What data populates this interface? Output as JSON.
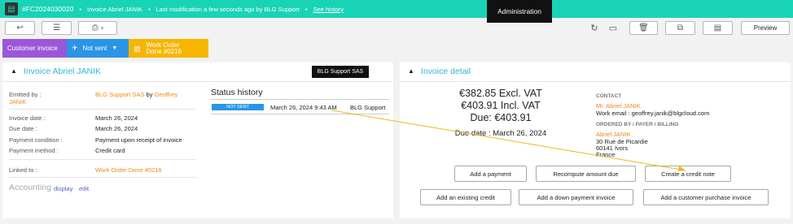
{
  "topbar": {
    "ref": "#FC2024030020",
    "title": "Invoice Abriel JANIK",
    "modification": "Last modification a few seconds ago by BLG Support",
    "history_link": "See history",
    "admin_badge": "Administration",
    "bg_color": "#19d3b6"
  },
  "toolbar": {
    "back_icon": "back-arrow-icon",
    "list_icon": "list-icon",
    "print_icon": "print-icon",
    "reload_icon": "reload-icon",
    "screen_icon": "monitor-icon",
    "trash_icon": "trash-icon",
    "copy_icon": "copy-icon",
    "doc_icon": "document-icon",
    "preview_label": "Preview"
  },
  "status": {
    "type": "Customer invoice",
    "sent": "Not sent",
    "order": "Work Order Done #0216"
  },
  "left_panel": {
    "title": "Invoice Abriel JANIK",
    "badge": "BLG Support SAS",
    "emitted_label": "Emitted by :",
    "emitted_company": "BLG Support SAS",
    "emitted_by": "by",
    "emitted_person": "Geoffrey JANIK",
    "rows": [
      {
        "label": "Invoice date :",
        "value": "March 26, 2024"
      },
      {
        "label": "Due date :",
        "value": "March 26, 2024"
      },
      {
        "label": "Payment condition :",
        "value": "Payment upon receipt of invoice"
      },
      {
        "label": "Payment method :",
        "value": "Credit card"
      }
    ],
    "linked_label": "Linked to :",
    "linked_value": "Work Order Done #0216",
    "accounting_label": "Accounting",
    "accounting_display": "display",
    "accounting_edit": "edit",
    "status_history_title": "Status history",
    "history": [
      {
        "status": "NOT SENT",
        "date": "March 26, 2024 9:43 AM",
        "user": "BLG Support"
      }
    ]
  },
  "right_panel": {
    "title": "Invoice detail",
    "excl_vat": "€382.85 Excl. VAT",
    "incl_vat": "€403.91 Incl. VAT",
    "due": "Due: €403.91",
    "due_date": "Due date : March 26, 2024",
    "contact_heading": "CONTACT",
    "contact_name": "Mr. Abriel JANIK",
    "contact_email": "Work email : geoffrey.janik@blgcloud.com",
    "ordered_heading": "ORDERED BY / PAYER / BILLING",
    "ordered_name": "Abriel JANIK",
    "address1": "30 Rue de Picardie",
    "address2": "60141 Ivors",
    "country": "France",
    "buttons": {
      "add_payment": "Add a payment",
      "recompute": "Recompute amount due",
      "credit_note": "Create a credit note",
      "existing_credit": "Add an existing credit",
      "down_payment": "Add a down payment invoice",
      "purchase_invoice": "Add a customer purchase invoice"
    }
  }
}
